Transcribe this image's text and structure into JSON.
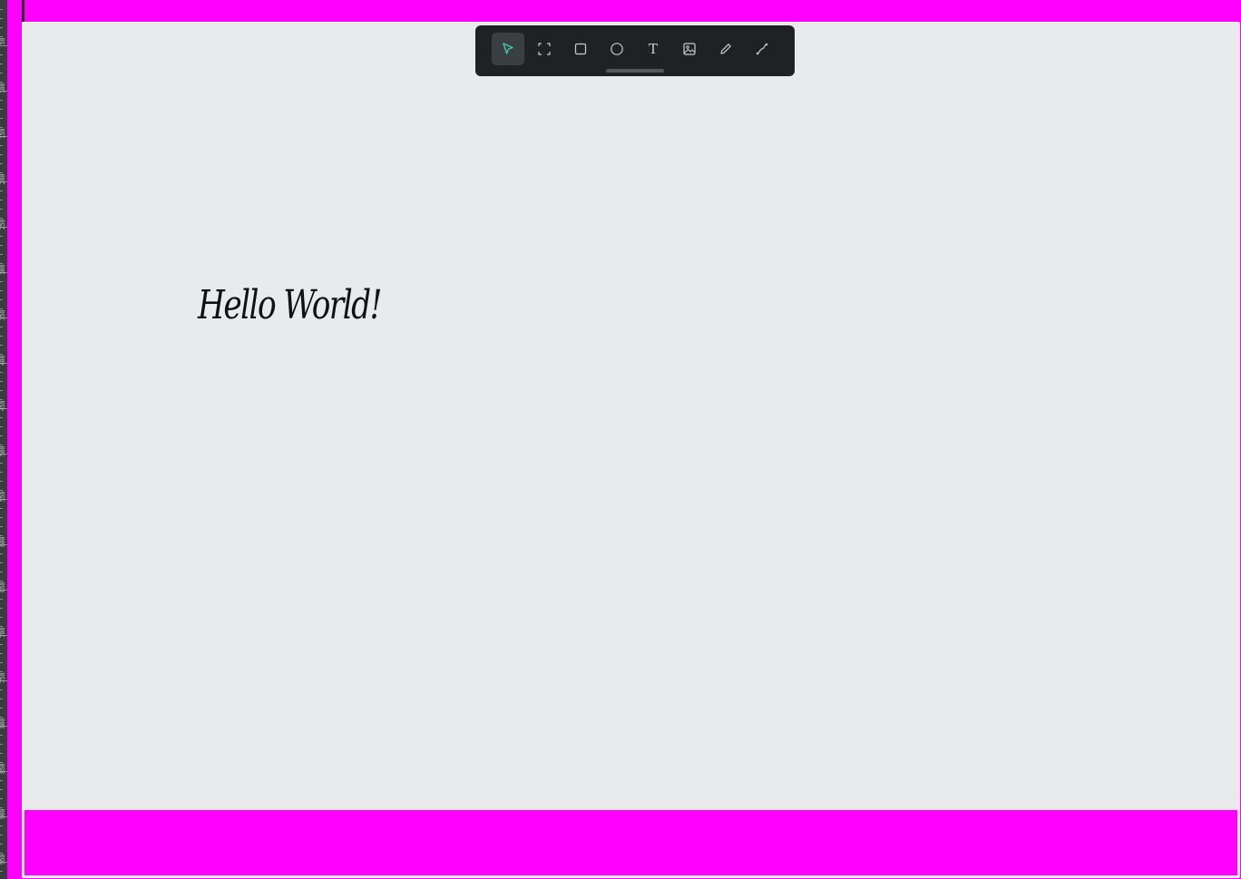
{
  "ruler": {
    "labels": [
      "50",
      "100",
      "150",
      "200",
      "250",
      "300",
      "350",
      "400",
      "450",
      "500",
      "550",
      "600",
      "650",
      "700",
      "750",
      "800",
      "850",
      "900",
      "950"
    ]
  },
  "toolbar": {
    "tools": [
      {
        "name": "select",
        "icon": "cursor-arrow-icon",
        "active": true
      },
      {
        "name": "frame",
        "icon": "frame-icon",
        "active": false
      },
      {
        "name": "rectangle",
        "icon": "rectangle-icon",
        "active": false
      },
      {
        "name": "ellipse",
        "icon": "ellipse-icon",
        "active": false
      },
      {
        "name": "text",
        "icon": "text-icon",
        "glyph": "T",
        "active": false
      },
      {
        "name": "image",
        "icon": "image-icon",
        "active": false
      },
      {
        "name": "pencil",
        "icon": "pencil-icon",
        "active": false
      },
      {
        "name": "path",
        "icon": "path-icon",
        "active": false
      }
    ]
  },
  "canvas": {
    "text_element": "Hello World!"
  },
  "colors": {
    "background": "#ff00ff",
    "canvas": "#e8eaeb",
    "toolbar": "#1f2123",
    "accent": "#3fd0b2"
  }
}
